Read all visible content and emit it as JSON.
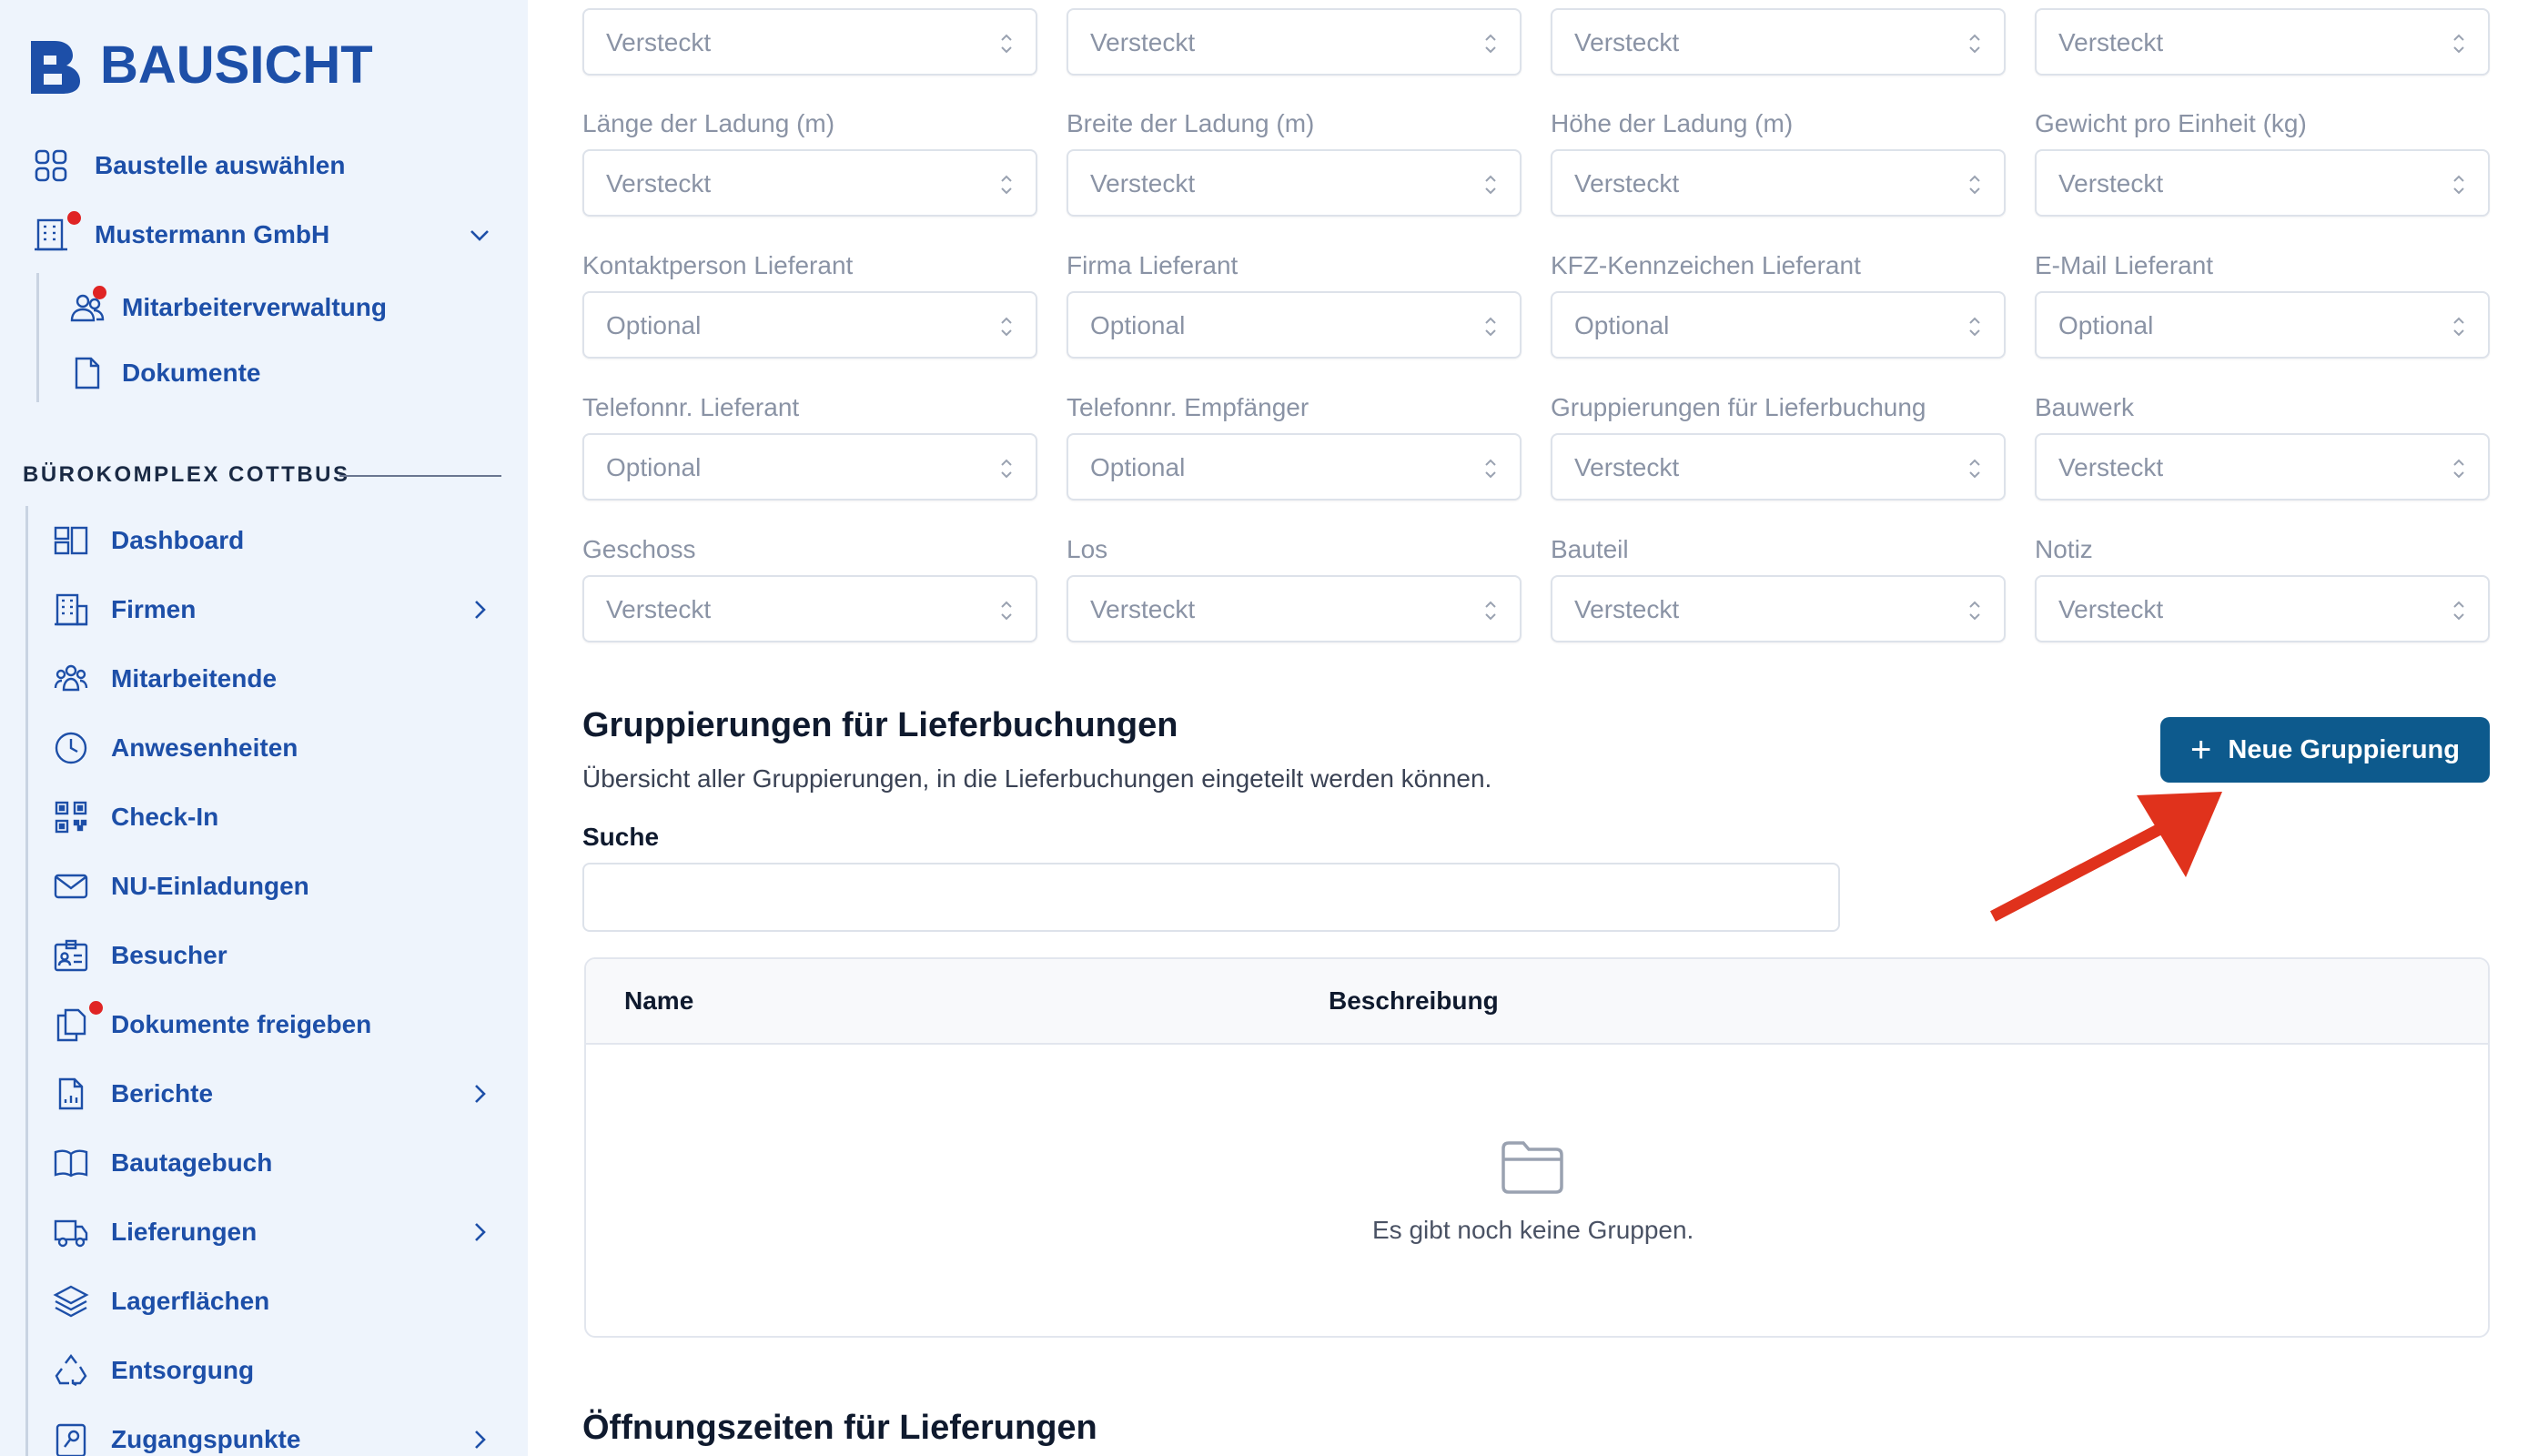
{
  "brand": {
    "name": "BAUSICHT",
    "color": "#1d4fa8"
  },
  "sidebar": {
    "top_items": [
      {
        "label": "Baustelle auswählen",
        "icon": "grid-icon"
      },
      {
        "label": "Mustermann GmbH",
        "icon": "building-icon",
        "notification": true,
        "expanded": true
      },
      {
        "label": "Mitarbeiterverwaltung",
        "icon": "users-icon",
        "notification": true
      },
      {
        "label": "Dokumente",
        "icon": "document-icon"
      }
    ],
    "section_title": "BÜROKOMPLEX COTTBUS",
    "items": [
      {
        "label": "Dashboard",
        "icon": "dashboard-icon"
      },
      {
        "label": "Firmen",
        "icon": "building-icon",
        "has_children": true
      },
      {
        "label": "Mitarbeitende",
        "icon": "people-icon"
      },
      {
        "label": "Anwesenheiten",
        "icon": "clock-icon"
      },
      {
        "label": "Check-In",
        "icon": "qr-code-icon"
      },
      {
        "label": "NU-Einladungen",
        "icon": "mail-icon"
      },
      {
        "label": "Besucher",
        "icon": "id-badge-icon"
      },
      {
        "label": "Dokumente freigeben",
        "icon": "documents-icon",
        "notification": true
      },
      {
        "label": "Berichte",
        "icon": "report-icon",
        "has_children": true
      },
      {
        "label": "Bautagebuch",
        "icon": "book-icon"
      },
      {
        "label": "Lieferungen",
        "icon": "truck-icon",
        "has_children": true
      },
      {
        "label": "Lagerflächen",
        "icon": "layers-icon"
      },
      {
        "label": "Entsorgung",
        "icon": "recycle-icon"
      },
      {
        "label": "Zugangspunkte",
        "icon": "access-icon",
        "has_children": true
      }
    ]
  },
  "fields": {
    "row0": [
      {
        "value": "Versteckt"
      },
      {
        "value": "Versteckt"
      },
      {
        "value": "Versteckt"
      },
      {
        "value": "Versteckt"
      }
    ],
    "row1": [
      {
        "label": "Länge der Ladung (m)",
        "value": "Versteckt"
      },
      {
        "label": "Breite der Ladung (m)",
        "value": "Versteckt"
      },
      {
        "label": "Höhe der Ladung (m)",
        "value": "Versteckt"
      },
      {
        "label": "Gewicht pro Einheit (kg)",
        "value": "Versteckt"
      }
    ],
    "row2": [
      {
        "label": "Kontaktperson Lieferant",
        "value": "Optional"
      },
      {
        "label": "Firma Lieferant",
        "value": "Optional"
      },
      {
        "label": "KFZ-Kennzeichen Lieferant",
        "value": "Optional"
      },
      {
        "label": "E-Mail Lieferant",
        "value": "Optional"
      }
    ],
    "row3": [
      {
        "label": "Telefonnr. Lieferant",
        "value": "Optional"
      },
      {
        "label": "Telefonnr. Empfänger",
        "value": "Optional"
      },
      {
        "label": "Gruppierungen für Lieferbuchung",
        "value": "Versteckt"
      },
      {
        "label": "Bauwerk",
        "value": "Versteckt"
      }
    ],
    "row4": [
      {
        "label": "Geschoss",
        "value": "Versteckt"
      },
      {
        "label": "Los",
        "value": "Versteckt"
      },
      {
        "label": "Bauteil",
        "value": "Versteckt"
      },
      {
        "label": "Notiz",
        "value": "Versteckt"
      }
    ]
  },
  "groupings": {
    "title": "Gruppierungen für Lieferbuchungen",
    "description": "Übersicht aller Gruppierungen, in die Lieferbuchungen eingeteilt werden können.",
    "new_button": "Neue Gruppierung",
    "search_label": "Suche",
    "search_value": "",
    "columns": [
      "Name",
      "Beschreibung"
    ],
    "empty_text": "Es gibt noch keine Gruppen.",
    "empty_icon": "folder-icon"
  },
  "opening_hours": {
    "title": "Öffnungszeiten für Lieferungen"
  },
  "annotation": {
    "icon": "red-arrow-icon",
    "color": "#e0321c"
  },
  "colors": {
    "primary": "#0d5a8d",
    "notification": "#e02424",
    "sidebar_bg": "#eef4fc"
  }
}
